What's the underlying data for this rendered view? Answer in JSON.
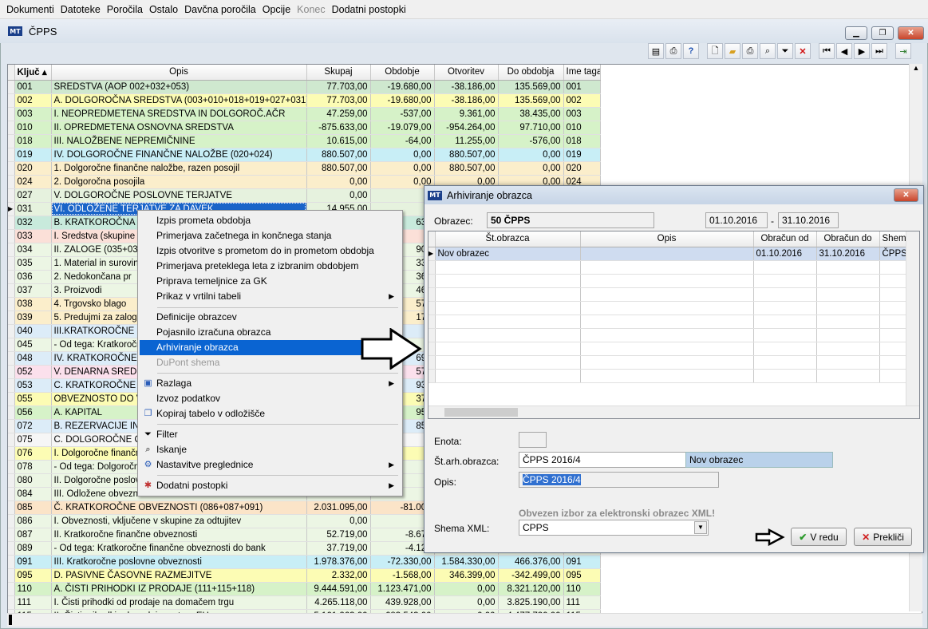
{
  "menubar": {
    "items": [
      "Dokumenti",
      "Datoteke",
      "Poročila",
      "Ostalo",
      "Davčna poročila",
      "Opcije",
      "Konec",
      "Dodatni postopki"
    ]
  },
  "window": {
    "title": "ČPPS",
    "app_icon": "MT"
  },
  "grid": {
    "columns": [
      "Ključ",
      "Opis",
      "Skupaj",
      "Obdobje",
      "Otvoritev",
      "Do obdobja",
      "Ime taga"
    ],
    "rows": [
      {
        "k": "001",
        "opis": "SREDSTVA (AOP 002+032+053)",
        "s": "77.703,00",
        "o": "-19.680,00",
        "ot": "-38.186,00",
        "d": "135.569,00",
        "t": "001",
        "c": "#cfe8cf"
      },
      {
        "k": "002",
        "opis": "A. DOLGOROČNA SREDSTVA (003+010+018+019+027+031)",
        "s": "77.703,00",
        "o": "-19.680,00",
        "ot": "-38.186,00",
        "d": "135.569,00",
        "t": "002",
        "c": "#fcfcb4"
      },
      {
        "k": "003",
        "opis": "I.  NEOPREDMETENA SREDSTVA IN DOLGOROČ.AČR",
        "s": "47.259,00",
        "o": "-537,00",
        "ot": "9.361,00",
        "d": "38.435,00",
        "t": "003",
        "c": "#d6f2c8"
      },
      {
        "k": "010",
        "opis": "II. OPREDMETENA OSNOVNA SREDSTVA",
        "s": "-875.633,00",
        "o": "-19.079,00",
        "ot": "-954.264,00",
        "d": "97.710,00",
        "t": "010",
        "c": "#d6f2c8"
      },
      {
        "k": "018",
        "opis": "III. NALOŽBENE NEPREMIČNINE",
        "s": "10.615,00",
        "o": "-64,00",
        "ot": "11.255,00",
        "d": "-576,00",
        "t": "018",
        "c": "#d6f2c8"
      },
      {
        "k": "019",
        "opis": "IV. DOLGOROČNE FINANČNE NALOŽBE (020+024)",
        "s": "880.507,00",
        "o": "0,00",
        "ot": "880.507,00",
        "d": "0,00",
        "t": "019",
        "c": "#c8eef6"
      },
      {
        "k": "020",
        "opis": "    1. Dolgoročne finančne naložbe, razen posojil",
        "s": "880.507,00",
        "o": "0,00",
        "ot": "880.507,00",
        "d": "0,00",
        "t": "020",
        "c": "#fbeecb"
      },
      {
        "k": "024",
        "opis": "    2. Dolgoročna posojila",
        "s": "0,00",
        "o": "0,00",
        "ot": "0,00",
        "d": "0,00",
        "t": "024",
        "c": "#fbeecb"
      },
      {
        "k": "027",
        "opis": "V. DOLGOROČNE POSLOVNE TERJATVE",
        "s": "0,00",
        "o": "0,",
        "ot": "",
        "d": "",
        "t": "",
        "c": "#e6f2de"
      },
      {
        "k": "031",
        "opis": "VI. ODLOŽENE TERJATVE ZA DAVEK",
        "s": "14.955,00",
        "o": "",
        "ot": "",
        "d": "",
        "t": "",
        "c": "#e6f2de",
        "sel": true
      },
      {
        "k": "032",
        "opis": "B. KRATKOROČNA S",
        "s": "",
        "o": "636",
        "ot": "",
        "d": "",
        "t": "",
        "c": "#c8eadc"
      },
      {
        "k": "033",
        "opis": "I.  Sredstva (skupine z",
        "s": "",
        "o": "0",
        "ot": "",
        "d": "",
        "t": "",
        "c": "#fbe0d8"
      },
      {
        "k": "034",
        "opis": "II.  ZALOGE (035+036",
        "s": "",
        "o": "905",
        "ot": "",
        "d": "",
        "t": "",
        "c": "#ecf6e4"
      },
      {
        "k": "035",
        "opis": "    1. Material in surovin",
        "s": "",
        "o": "334",
        "ot": "",
        "d": "",
        "t": "",
        "c": "#ecf6e4"
      },
      {
        "k": "036",
        "opis": "    2. Nedokončana pr",
        "s": "",
        "o": "365",
        "ot": "",
        "d": "",
        "t": "",
        "c": "#ecf6e4"
      },
      {
        "k": "037",
        "opis": "    3. Proizvodi",
        "s": "",
        "o": "460",
        "ot": "",
        "d": "",
        "t": "",
        "c": "#ecf6e4"
      },
      {
        "k": "038",
        "opis": "    4. Trgovsko blago",
        "s": "",
        "o": "574",
        "ot": "",
        "d": "",
        "t": "",
        "c": "#fbeecb"
      },
      {
        "k": "039",
        "opis": "    5. Predujmi za zalog",
        "s": "",
        "o": "172",
        "ot": "",
        "d": "",
        "t": "",
        "c": "#fbeecb"
      },
      {
        "k": "040",
        "opis": "III.KRATKOROČNE FI",
        "s": "",
        "o": "0",
        "ot": "",
        "d": "",
        "t": "",
        "c": "#dcecf8"
      },
      {
        "k": "045",
        "opis": "- Od tega: Kratkoročn",
        "s": "",
        "o": "0",
        "ot": "",
        "d": "",
        "t": "",
        "c": "#ecf6e4"
      },
      {
        "k": "048",
        "opis": "IV.  KRATKOROČNE",
        "s": "",
        "o": "696",
        "ot": "",
        "d": "",
        "t": "",
        "c": "#dcecf8"
      },
      {
        "k": "052",
        "opis": "V. DENARNA SREDS",
        "s": "",
        "o": "573",
        "ot": "",
        "d": "",
        "t": "",
        "c": "#fbe0ec"
      },
      {
        "k": "053",
        "opis": "C. KRATKOROČNE A",
        "s": "",
        "o": "935",
        "ot": "",
        "d": "",
        "t": "",
        "c": "#dcecf8"
      },
      {
        "k": "055",
        "opis": "OBVEZNOSTO DO VI",
        "s": "",
        "o": "379",
        "ot": "",
        "d": "",
        "t": "",
        "c": "#fcfcb4"
      },
      {
        "k": "056",
        "opis": "A. KAPITAL",
        "s": "",
        "o": "954",
        "ot": "",
        "d": "",
        "t": "",
        "c": "#d6f2c8"
      },
      {
        "k": "072",
        "opis": "B. REZERVACIJE IN",
        "s": "",
        "o": "857",
        "ot": "",
        "d": "",
        "t": "",
        "c": "#dcecf8"
      },
      {
        "k": "075",
        "opis": "C. DOLGOROČNE OB",
        "s": "",
        "o": "0",
        "ot": "",
        "d": "",
        "t": "",
        "c": "#f6f6f6"
      },
      {
        "k": "076",
        "opis": "I.  Dolgoročne finančn",
        "s": "",
        "o": "0",
        "ot": "",
        "d": "",
        "t": "",
        "c": "#fcfcb4"
      },
      {
        "k": "078",
        "opis": "- Od tega: Dolgoročne",
        "s": "",
        "o": "0",
        "ot": "",
        "d": "",
        "t": "",
        "c": "#ecf6e4"
      },
      {
        "k": "080",
        "opis": "II.  Dolgoročne poslov",
        "s": "",
        "o": "0",
        "ot": "",
        "d": "",
        "t": "",
        "c": "#ecf6e4"
      },
      {
        "k": "084",
        "opis": "III. Odložene obvezno",
        "s": "",
        "o": "0",
        "ot": "",
        "d": "",
        "t": "",
        "c": "#ecf6e4"
      },
      {
        "k": "085",
        "opis": "Č. KRATKOROČNE OBVEZNOSTI (086+087+091)",
        "s": "2.031.095,00",
        "o": "-81.000",
        "ot": "",
        "d": "",
        "t": "",
        "c": "#fbe4c8"
      },
      {
        "k": "086",
        "opis": "I.  Obveznosti, vključene v skupine za odtujitev",
        "s": "0,00",
        "o": "",
        "ot": "",
        "d": "",
        "t": "",
        "c": "#ecf6e4"
      },
      {
        "k": "087",
        "opis": "II.  Kratkoročne finančne obveznosti",
        "s": "52.719,00",
        "o": "-8.670",
        "ot": "",
        "d": "",
        "t": "",
        "c": "#ecf6e4"
      },
      {
        "k": "089",
        "opis": "- Od tega: Kratkoročne finančne obveznosti do bank",
        "s": "37.719,00",
        "o": "-4.127",
        "ot": "",
        "d": "",
        "t": "",
        "c": "#ecf6e4"
      },
      {
        "k": "091",
        "opis": "III. Kratkoročne poslovne obveznosti",
        "s": "1.978.376,00",
        "o": "-72.330,00",
        "ot": "1.584.330,00",
        "d": "466.376,00",
        "t": "091",
        "c": "#c8eef6"
      },
      {
        "k": "095",
        "opis": "D. PASIVNE ČASOVNE RAZMEJITVE",
        "s": "2.332,00",
        "o": "-1.568,00",
        "ot": "346.399,00",
        "d": "-342.499,00",
        "t": "095",
        "c": "#fcfcb4"
      },
      {
        "k": "110",
        "opis": "A. ČISTI PRIHODKI IZ PRODAJE (111+115+118)",
        "s": "9.444.591,00",
        "o": "1.123.471,00",
        "ot": "0,00",
        "d": "8.321.120,00",
        "t": "110",
        "c": "#d6f2c8"
      },
      {
        "k": "111",
        "opis": "I. Čisti prihodki od prodaje na domačem trgu",
        "s": "4.265.118,00",
        "o": "439.928,00",
        "ot": "0,00",
        "d": "3.825.190,00",
        "t": "111",
        "c": "#ecf6e4"
      },
      {
        "k": "115",
        "opis": "II. Čisti prihodki od prodaje na trgu EU",
        "s": "5.161.263,00",
        "o": "683.543,00",
        "ot": "0,00",
        "d": "4.477.720,00",
        "t": "115",
        "c": "#ecf6e4"
      }
    ]
  },
  "context_menu": {
    "items": [
      {
        "label": "Izpis prometa obdobja"
      },
      {
        "label": "Primerjava začetnega in končnega stanja"
      },
      {
        "label": "Izpis otvoritve s prometom do in prometom obdobja"
      },
      {
        "label": "Primerjava preteklega leta z izbranim obdobjem"
      },
      {
        "label": "Priprava temeljnice za GK"
      },
      {
        "label": "Prikaz v vrtilni tabeli",
        "sub": true
      },
      {
        "label": "Definicije obrazcev"
      },
      {
        "label": "Pojasnilo izračuna obrazca"
      },
      {
        "label": "Arhiviranje obrazca",
        "hl": true
      },
      {
        "label": "DuPont shema",
        "dis": true
      },
      {
        "label": "Razlaga",
        "sub": true
      },
      {
        "label": "Izvoz podatkov"
      },
      {
        "label": "Kopiraj tabelo v odložišče"
      },
      {
        "label": "Filter"
      },
      {
        "label": "Iskanje"
      },
      {
        "label": "Nastavitve preglednice",
        "sub": true
      },
      {
        "label": "Dodatni postopki",
        "sub": true
      }
    ]
  },
  "dialog": {
    "title": "Arhiviranje obrazca",
    "obrazec_label": "Obrazec:",
    "obrazec_value": "50  ČPPS",
    "date_from": "01.10.2016",
    "date_sep": "-",
    "date_to": "31.10.2016",
    "columns": [
      "Št.obrazca",
      "Opis",
      "Obračun od",
      "Obračun do",
      "Shema"
    ],
    "rows": [
      {
        "st": "Nov obrazec",
        "opis": "",
        "od": "01.10.2016",
        "do": "31.10.2016",
        "shema": "ČPPS"
      }
    ],
    "enota_label": "Enota:",
    "starh_label": "Št.arh.obrazca:",
    "starh_value": "ČPPS 2016/4",
    "starh_note": "Nov obrazec",
    "opis_label": "Opis:",
    "opis_value": "ČPPS 2016/4",
    "xml_warning": "Obvezen izbor za elektronski obrazec XML!",
    "shema_label": "Shema XML:",
    "shema_value": "CPPS",
    "ok_label": "V redu",
    "cancel_label": "Prekliči"
  }
}
